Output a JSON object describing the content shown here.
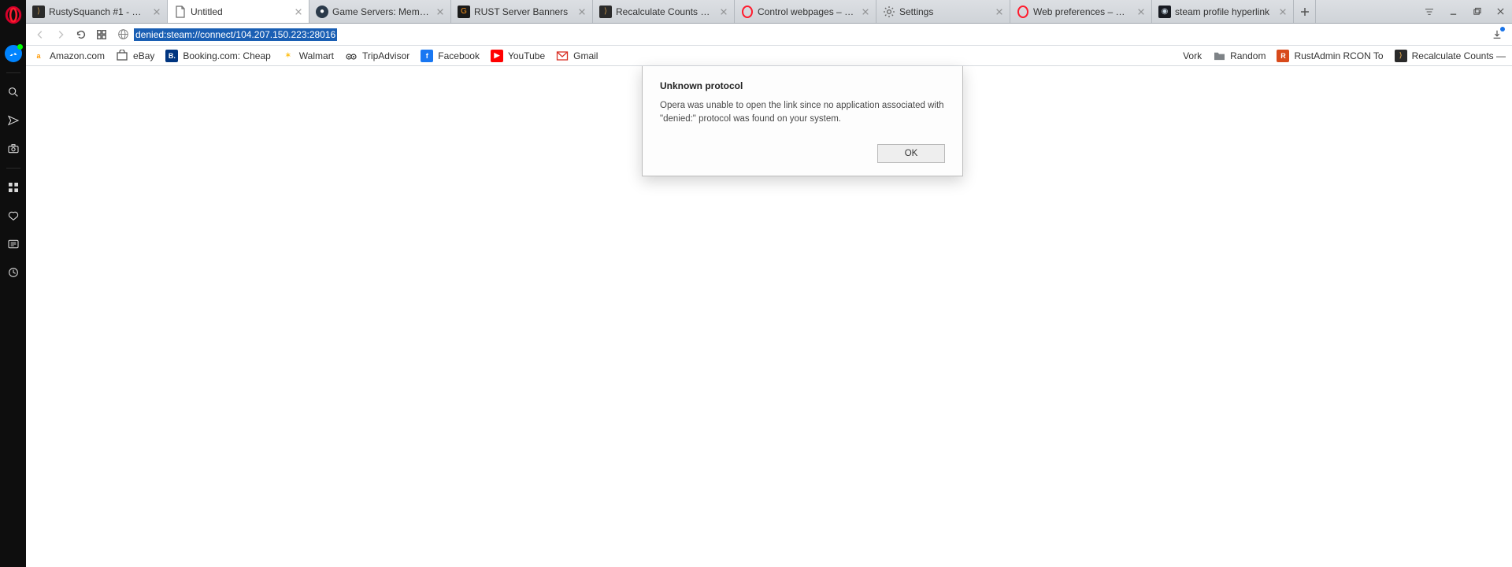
{
  "tabs": [
    {
      "title": "RustySquanch #1 - Serv"
    },
    {
      "title": "Untitled"
    },
    {
      "title": "Game Servers: Members"
    },
    {
      "title": "RUST Server Banners"
    },
    {
      "title": "Recalculate Counts — R"
    },
    {
      "title": "Control webpages – Ope"
    },
    {
      "title": "Settings"
    },
    {
      "title": "Web preferences – Oper"
    },
    {
      "title": "steam profile hyperlink"
    }
  ],
  "url": "denied:steam://connect/104.207.150.223:28016",
  "bookmarks": [
    {
      "label": "Amazon.com"
    },
    {
      "label": "eBay"
    },
    {
      "label": "Booking.com: Cheap"
    },
    {
      "label": "Walmart"
    },
    {
      "label": "TripAdvisor"
    },
    {
      "label": "Facebook"
    },
    {
      "label": "YouTube"
    },
    {
      "label": "Gmail"
    },
    {
      "label": "Vork"
    },
    {
      "label": "Random"
    },
    {
      "label": "RustAdmin RCON To"
    },
    {
      "label": "Recalculate Counts —"
    }
  ],
  "dialog": {
    "title": "Unknown protocol",
    "body": "Opera was unable to open the link since no application associated with \"denied:\" protocol was found on your system.",
    "ok": "OK"
  }
}
